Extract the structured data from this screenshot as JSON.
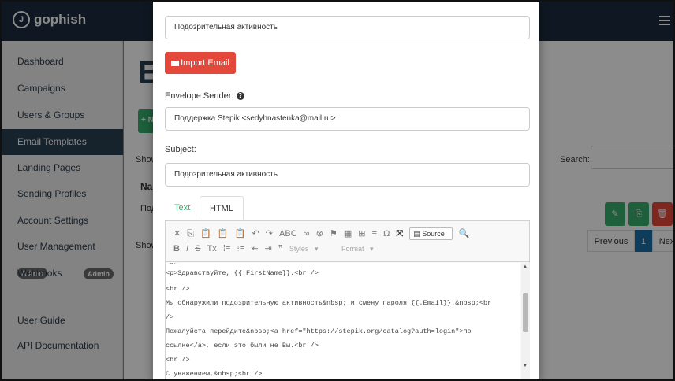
{
  "app": {
    "brand": "gophish",
    "logo_glyph": "J"
  },
  "sidebar": {
    "items": [
      {
        "label": "Dashboard"
      },
      {
        "label": "Campaigns"
      },
      {
        "label": "Users & Groups"
      },
      {
        "label": "Email Templates"
      },
      {
        "label": "Landing Pages"
      },
      {
        "label": "Sending Profiles"
      },
      {
        "label": "Account Settings"
      },
      {
        "label": "User Management",
        "badge": "Admin"
      },
      {
        "label": "Webhooks",
        "badge": "Admin"
      },
      {
        "label": "User Guide"
      },
      {
        "label": "API Documentation"
      }
    ]
  },
  "page": {
    "title_fragment": "E",
    "new_button_fragment": "+ N",
    "show_top": "Show",
    "show_bottom": "Showi",
    "column_name": "Nam",
    "row_name": "Под",
    "search_label": "Search:",
    "pager": {
      "previous": "Previous",
      "current": "1",
      "next": "Next"
    }
  },
  "modal": {
    "name_value": "Подозрительная активность",
    "import_label": "Import Email",
    "envelope_label": "Envelope Sender:",
    "help_glyph": "?",
    "envelope_value": "Поддержка Stepik <sedyhnastenka@mail.ru>",
    "subject_label": "Subject:",
    "subject_value": "Подозрительная активность",
    "tabs": {
      "text": "Text",
      "html": "HTML"
    },
    "toolbar": {
      "row1": [
        "✕",
        "⎘",
        "📋",
        "📋",
        "📋",
        "↶",
        "↷",
        "ABC",
        "∞",
        "⊗",
        "⚑",
        "▦",
        "⊞",
        "≡",
        "Ω",
        "⤧"
      ],
      "source_label": "Source",
      "row2": [
        "B",
        "I",
        "S",
        "Tx",
        "⁞≡",
        "⁝≡",
        "⇤",
        "⇥",
        "❞"
      ],
      "styles_label": "Styles",
      "format_label": "Format"
    },
    "code_lines": [
      "<p>Здравствуйте, {{.FirstName}}.<br />",
      "<br />",
      "Мы обнаружили подозрительную активность&nbsp; и смену пароля {{.Email}}.&nbsp;<br",
      "/>",
      "Пожалуйста перейдите&nbsp;<a href=\"https://stepik.org/catalog?auth=login\">по",
      "ссылке</a>, если это были не Вы.<br />",
      "<br />",
      "С уважением,&nbsp;<br />"
    ]
  },
  "colors": {
    "navbar": "#1c2d3f",
    "sidebar_active": "#283f50",
    "import_button": "#e4483b",
    "accent_green": "#37b06e",
    "pager_active": "#1c6ea4"
  }
}
